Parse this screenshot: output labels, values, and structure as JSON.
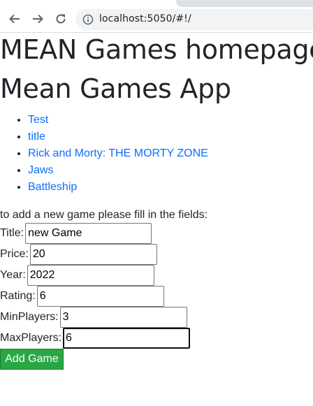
{
  "browser": {
    "url": "localhost:5050/#!/",
    "icons": {
      "back": "arrow-left-icon",
      "forward": "arrow-right-icon",
      "reload": "reload-icon",
      "site_info": "info-icon"
    }
  },
  "page": {
    "heading1": "MEAN Games homepage",
    "heading2": "Mean Games App",
    "games": [
      {
        "title": "Test"
      },
      {
        "title": "title"
      },
      {
        "title": "Rick and Morty: THE MORTY ZONE"
      },
      {
        "title": "Jaws"
      },
      {
        "title": "Battleship"
      }
    ],
    "link_color": "#0d6efd"
  },
  "form": {
    "intro": "to add a new game please fill in the fields:",
    "fields": [
      {
        "label": "Title:",
        "value": "new Game"
      },
      {
        "label": "Price:",
        "value": "20"
      },
      {
        "label": "Year:",
        "value": "2022"
      },
      {
        "label": "Rating:",
        "value": "6"
      },
      {
        "label": "MinPlayers:",
        "value": "3"
      },
      {
        "label": "MaxPlayers:",
        "value": "6",
        "focused": true
      }
    ],
    "submit_label": "Add Game",
    "submit_color": "#28a745"
  }
}
